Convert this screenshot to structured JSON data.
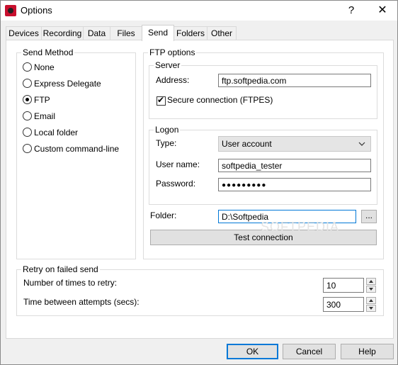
{
  "window": {
    "title": "Options",
    "help_glyph": "?",
    "close_glyph": "✕"
  },
  "tabs": [
    {
      "label": "Devices"
    },
    {
      "label": "Recording"
    },
    {
      "label": "Data"
    },
    {
      "label": "Files"
    },
    {
      "label": "Send"
    },
    {
      "label": "Folders"
    },
    {
      "label": "Other"
    }
  ],
  "active_tab": "Send",
  "send_method": {
    "label": "Send Method",
    "options": [
      "None",
      "Express Delegate",
      "FTP",
      "Email",
      "Local folder",
      "Custom command-line"
    ],
    "selected": "FTP"
  },
  "ftp": {
    "label": "FTP options",
    "server": {
      "label": "Server",
      "address_label": "Address:",
      "address_value": "ftp.softpedia.com",
      "secure_label": "Secure connection (FTPES)",
      "secure_checked": true
    },
    "logon": {
      "label": "Logon",
      "type_label": "Type:",
      "type_value": "User account",
      "username_label": "User name:",
      "username_value": "softpedia_tester",
      "password_label": "Password:",
      "password_value": "●●●●●●●●●"
    },
    "folder_label": "Folder:",
    "folder_value": "D:\\Softpedia",
    "browse_label": "...",
    "test_label": "Test connection"
  },
  "retry": {
    "label": "Retry on failed send",
    "times_label": "Number of times to retry:",
    "times_value": "10",
    "between_label": "Time between attempts (secs):",
    "between_value": "300"
  },
  "watermark": "SOFTPEDIA",
  "buttons": {
    "ok": "OK",
    "cancel": "Cancel",
    "help": "Help"
  }
}
